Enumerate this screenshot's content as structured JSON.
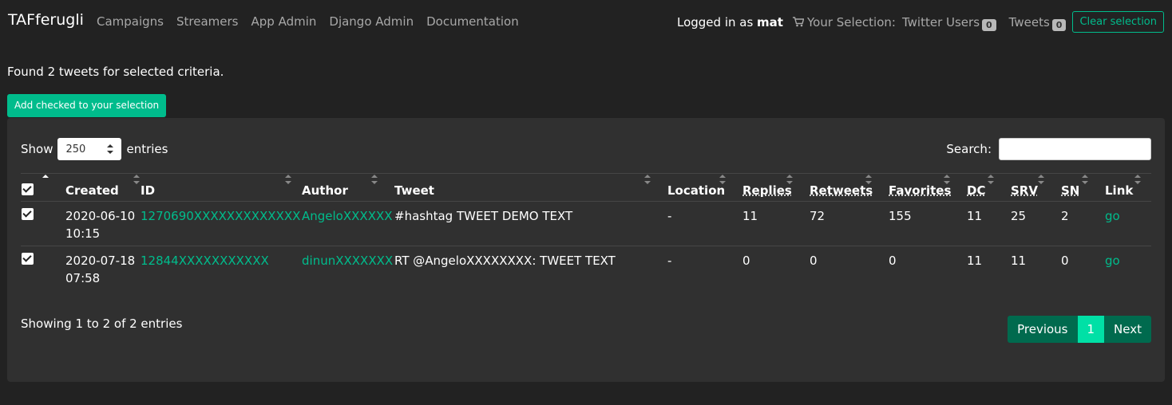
{
  "navbar": {
    "brand": "TAFferugli",
    "links": [
      "Campaigns",
      "Streamers",
      "App Admin",
      "Django Admin",
      "Documentation"
    ],
    "logged_prefix": "Logged in as",
    "username": "mat",
    "selection_label": "Your Selection:",
    "twitter_users_label": "Twitter Users",
    "twitter_users_count": "0",
    "tweets_label": "Tweets",
    "tweets_count": "0",
    "clear_selection": "Clear selection"
  },
  "found_text": "Found 2 tweets for selected criteria.",
  "add_button": "Add checked to your selection",
  "table_controls": {
    "show_label": "Show",
    "entries_value": "250",
    "entries_label": "entries",
    "search_label": "Search:",
    "search_value": ""
  },
  "table": {
    "columns": [
      "Created",
      "ID",
      "Author",
      "Tweet",
      "Location",
      "Replies",
      "Retweets",
      "Favorites",
      "DC",
      "SRV",
      "SN",
      "Link"
    ],
    "rows": [
      {
        "created_date": "2020-06-10",
        "created_time": "10:15",
        "id": "1270690XXXXXXXXXXXXX",
        "author": "AngeloXXXXXX",
        "tweet": "#hashtag TWEET DEMO TEXT",
        "location": "-",
        "replies": "11",
        "retweets": "72",
        "favorites": "155",
        "dc": "11",
        "srv": "25",
        "sn": "2",
        "link": "go"
      },
      {
        "created_date": "2020-07-18",
        "created_time": "07:58",
        "id": "12844XXXXXXXXXXX",
        "author": "dinunXXXXXXX",
        "tweet": "RT @AngeloXXXXXXXX: TWEET TEXT",
        "location": "-",
        "replies": "0",
        "retweets": "0",
        "favorites": "0",
        "dc": "11",
        "srv": "11",
        "sn": "0",
        "link": "go"
      }
    ]
  },
  "info_text": "Showing 1 to 2 of 2 entries",
  "pagination": {
    "previous": "Previous",
    "current_page": "1",
    "next": "Next"
  },
  "colors": {
    "background": "#222222",
    "panel": "#303030",
    "accent": "#00bc8c",
    "pager_bg": "#006a4e",
    "pager_active": "#00e0a6"
  }
}
